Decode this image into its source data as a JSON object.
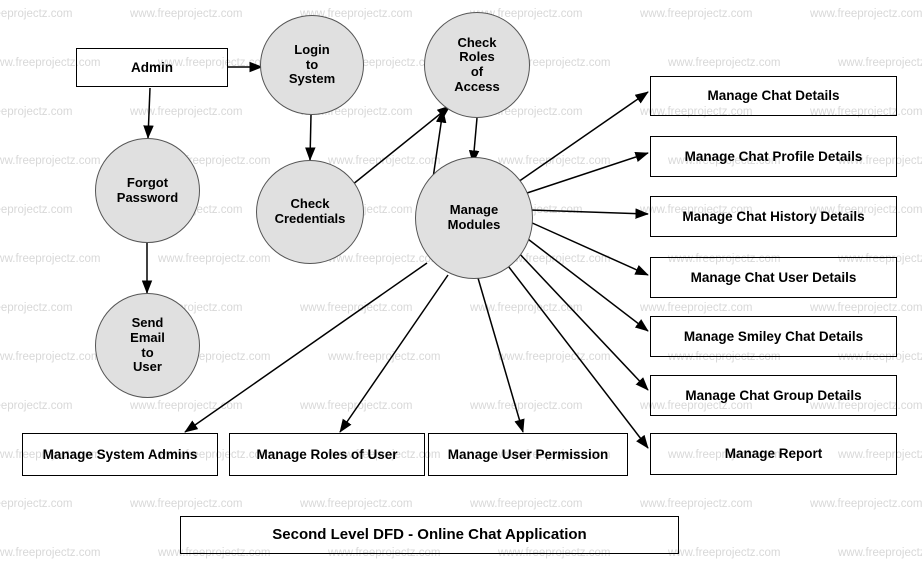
{
  "diagram": {
    "caption": "Second Level DFD - Online Chat Application",
    "watermark_text": "www.freeprojectz.com",
    "colors": {
      "process_fill": "#e0e0e0",
      "process_stroke": "#555555",
      "box_stroke": "#000000",
      "arrow": "#000000",
      "watermark": "#d8d8d8"
    },
    "external_entities": [
      {
        "id": "admin",
        "label": "Admin"
      }
    ],
    "processes": [
      {
        "id": "login",
        "label": "Login\nto\nSystem",
        "lines": [
          "Login",
          "to",
          "System"
        ]
      },
      {
        "id": "check_roles",
        "label": "Check\nRoles\nof\nAccess",
        "lines": [
          "Check",
          "Roles",
          "of",
          "Access"
        ]
      },
      {
        "id": "forgot",
        "label": "Forgot\nPassword",
        "lines": [
          "Forgot",
          "Password"
        ]
      },
      {
        "id": "check_cred",
        "label": "Check\nCredentials",
        "lines": [
          "Check",
          "Credentials"
        ]
      },
      {
        "id": "manage_modules",
        "label": "Manage\nModules",
        "lines": [
          "Manage",
          "Modules"
        ]
      },
      {
        "id": "send_email",
        "label": "Send\nEmail\nto\nUser",
        "lines": [
          "Send",
          "Email",
          "to",
          "User"
        ]
      }
    ],
    "data_stores_right": [
      {
        "id": "chat_details",
        "label": "Manage Chat Details"
      },
      {
        "id": "chat_profile",
        "label": "Manage Chat Profile Details"
      },
      {
        "id": "chat_history",
        "label": "Manage Chat History Details"
      },
      {
        "id": "chat_user",
        "label": "Manage Chat User Details"
      },
      {
        "id": "smiley_chat",
        "label": "Manage Smiley Chat Details"
      },
      {
        "id": "chat_group",
        "label": "Manage Chat Group Details"
      },
      {
        "id": "report",
        "label": "Manage Report"
      }
    ],
    "data_stores_bottom": [
      {
        "id": "system_admins",
        "label": "Manage System Admins"
      },
      {
        "id": "roles_of_user",
        "label": "Manage Roles of User"
      },
      {
        "id": "user_permission",
        "label": "Manage User Permission"
      }
    ],
    "flows": [
      {
        "from": "admin",
        "to": "login"
      },
      {
        "from": "admin",
        "to": "forgot"
      },
      {
        "from": "forgot",
        "to": "send_email"
      },
      {
        "from": "login",
        "to": "check_cred"
      },
      {
        "from": "check_cred",
        "to": "check_roles"
      },
      {
        "from": "check_roles",
        "to": "manage_modules"
      },
      {
        "from": "manage_modules",
        "to": "check_roles"
      },
      {
        "from": "manage_modules",
        "to": "chat_details"
      },
      {
        "from": "manage_modules",
        "to": "chat_profile"
      },
      {
        "from": "manage_modules",
        "to": "chat_history"
      },
      {
        "from": "manage_modules",
        "to": "chat_user"
      },
      {
        "from": "manage_modules",
        "to": "smiley_chat"
      },
      {
        "from": "manage_modules",
        "to": "chat_group"
      },
      {
        "from": "manage_modules",
        "to": "report"
      },
      {
        "from": "manage_modules",
        "to": "system_admins"
      },
      {
        "from": "manage_modules",
        "to": "roles_of_user"
      },
      {
        "from": "manage_modules",
        "to": "user_permission"
      }
    ]
  }
}
